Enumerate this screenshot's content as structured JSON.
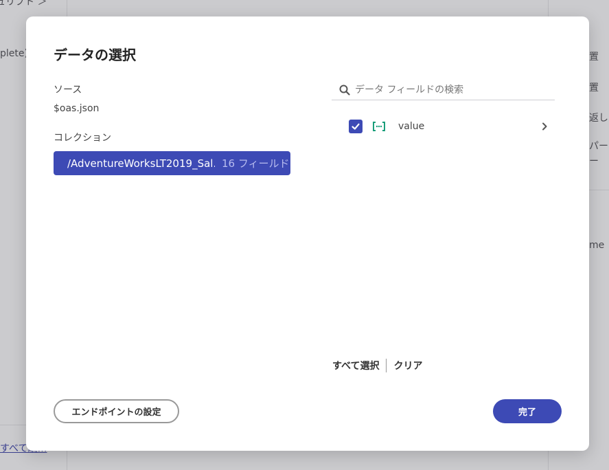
{
  "background": {
    "left_texts": [
      "ュリプト ＞",
      "plete)"
    ],
    "left_link": "すべて編…",
    "right_texts": [
      "置",
      "置",
      "返し",
      "パー",
      "ー",
      "me"
    ]
  },
  "dialog": {
    "title": "データの選択",
    "source_label": "ソース",
    "source_value": "$oas.json",
    "collection_label": "コレクション",
    "collections": [
      {
        "name": "/AdventureWorksLT2019_Sal...",
        "count": "16 フィールド"
      }
    ],
    "search": {
      "placeholder": "データ フィールドの検索",
      "value": ""
    },
    "fields": [
      {
        "name": "value",
        "checked": true,
        "icon": "array-icon"
      }
    ],
    "select_all_label": "すべて選択",
    "clear_label": "クリア",
    "endpoint_button_label": "エンドポイントの設定",
    "done_button_label": "完了",
    "accent_color": "#3d4ab5",
    "array_icon_color": "#1a9e7a"
  }
}
